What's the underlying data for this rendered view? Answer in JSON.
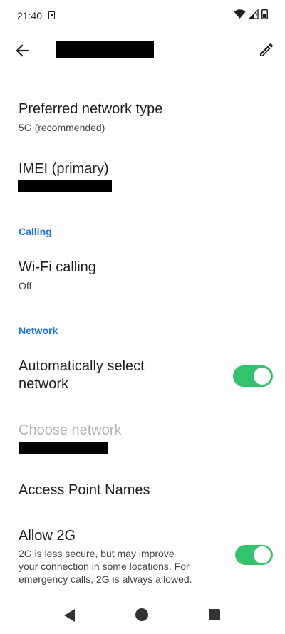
{
  "status_bar": {
    "time": "21:40",
    "sim_icon": "sim-card-icon",
    "icons": [
      "wifi-icon",
      "signal-icon",
      "battery-icon"
    ]
  },
  "toolbar": {
    "back_icon": "arrow-back-icon",
    "edit_icon": "pencil-icon"
  },
  "rows": {
    "preferred_network": {
      "title": "Preferred network type",
      "summary": "5G (recommended)"
    },
    "imei": {
      "title": "IMEI (primary)"
    },
    "calling_header": "Calling",
    "wifi_calling": {
      "title": "Wi-Fi calling",
      "summary": "Off"
    },
    "network_header": "Network",
    "auto_select": {
      "title_line1": "Automatically select",
      "title_line2": "network",
      "toggle_on": true
    },
    "choose_network": {
      "title": "Choose network",
      "enabled": false
    },
    "apn": {
      "title": "Access Point Names"
    },
    "allow_2g": {
      "title": "Allow 2G",
      "summary_line1": "2G is less secure, but may improve",
      "summary_line2": "your connection in some locations. For",
      "summary_line3": "emergency calls, 2G is always allowed.",
      "toggle_on": true
    }
  },
  "colors": {
    "accent": "#1a73e8",
    "toggle_on": "#34c36d",
    "disabled_text": "#b3b3b3"
  },
  "nav_bar": {
    "icons": [
      "nav-back-icon",
      "nav-home-icon",
      "nav-recents-icon"
    ]
  }
}
